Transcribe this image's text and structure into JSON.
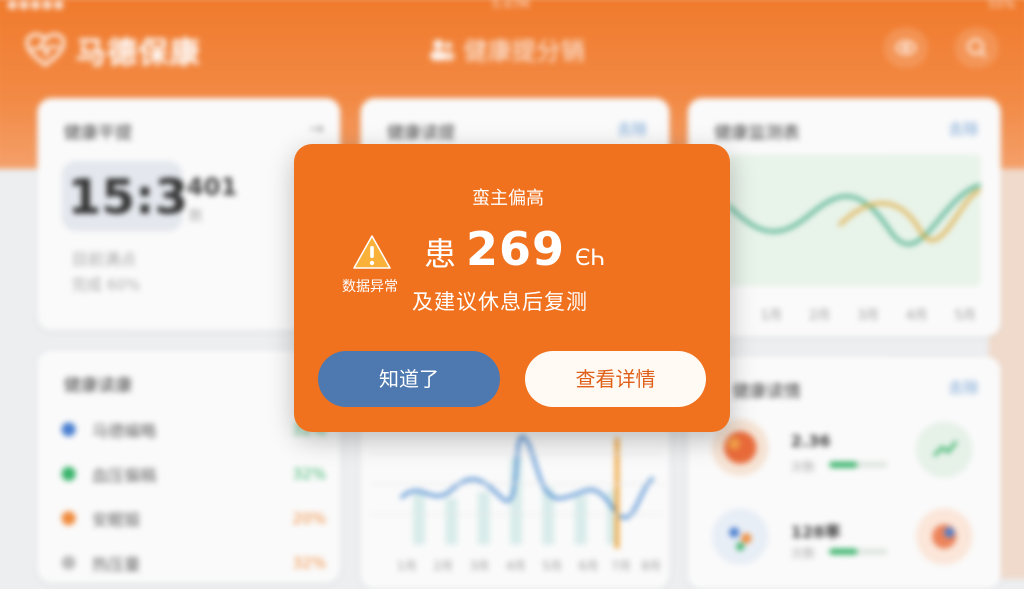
{
  "status_bar": {
    "signal": "●●●●● ",
    "time": "5:47M",
    "battery": "55%"
  },
  "header": {
    "app_name": "马德保康",
    "nav_title": "健康提分销"
  },
  "cards": {
    "c1": {
      "title": "健康平提",
      "time_value": "15:3",
      "side_value": "401",
      "side_dot": "数",
      "line1": "目前满点",
      "line2": "完成 60%"
    },
    "c2": {
      "title": "健康读提",
      "more": "去除"
    },
    "c3": {
      "title": "健康监测表",
      "more": "去除",
      "x_labels": [
        "1月",
        "2月",
        "3月",
        "4月",
        "5月"
      ]
    },
    "c4": {
      "title": "健康读康",
      "items": [
        {
          "label": "马德编略",
          "pct": "32%",
          "color": "#4a7fd0"
        },
        {
          "label": "血压偏稿",
          "pct": "32%",
          "color": "#38b36a"
        },
        {
          "label": "安眠锻",
          "pct": "20%",
          "color": "#f08a3a"
        },
        {
          "label": "热压量",
          "pct": "32%",
          "color": "#bbbbbb"
        }
      ]
    },
    "c5": {
      "x_labels": [
        "1月",
        "2月",
        "3月",
        "4月",
        "5月",
        "6月",
        "7月",
        "8月"
      ]
    },
    "c6": {
      "title": "健康读情",
      "more": "去除",
      "rows": [
        {
          "value": "2.36",
          "sub": "次数"
        },
        {
          "value": "128率",
          "sub": "次数"
        }
      ]
    }
  },
  "modal": {
    "title": "蛮主偏高",
    "warning_label": "数据异常",
    "value_prefix": "患",
    "value": "269",
    "unit": "ЄҺ",
    "message": "及建议休息后复测",
    "btn_ok": "知道了",
    "btn_detail": "查看详情"
  },
  "colors": {
    "brand": "#f0721f",
    "ok_button": "#4e79b0",
    "detail_button_bg": "#fffaf4"
  }
}
